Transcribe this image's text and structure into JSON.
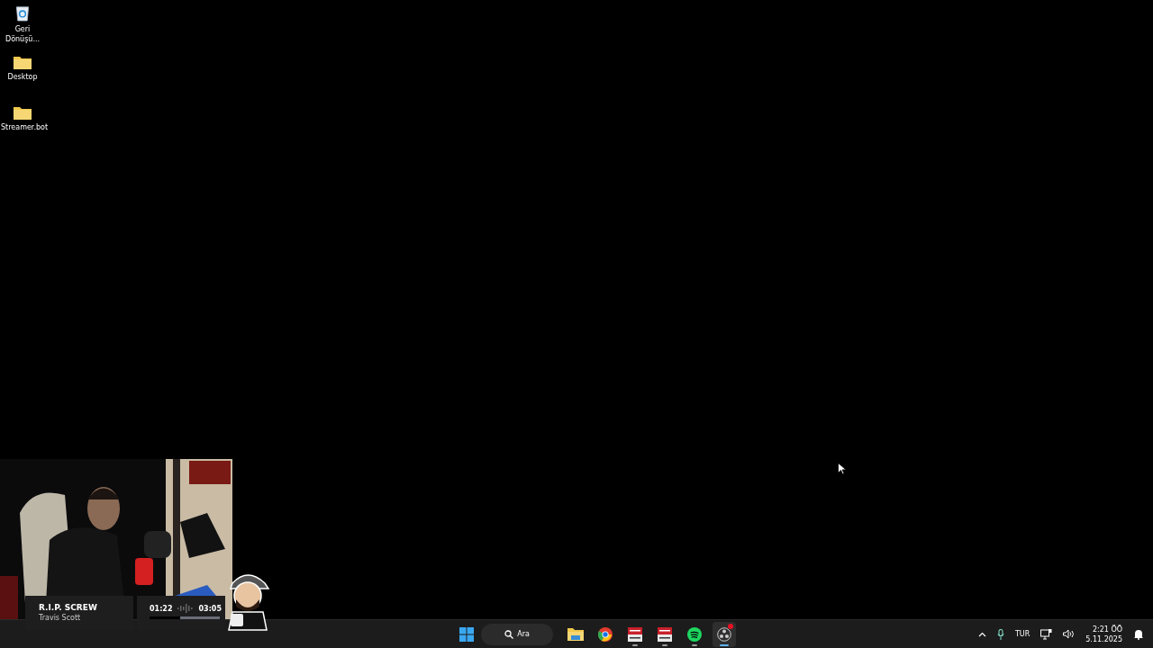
{
  "desktop_icons": [
    {
      "kind": "recycle",
      "label": "Geri Dönüşü..."
    },
    {
      "kind": "folder",
      "label": "Desktop"
    },
    {
      "kind": "folder",
      "label": "Streamer.bot"
    }
  ],
  "media": {
    "title": "R.I.P. SCREW",
    "artist": "Travis Scott",
    "elapsed": "01:22",
    "duration": "03:05",
    "level": 0.43
  },
  "taskbar": {
    "search": {
      "label": "Ara"
    },
    "apps": [
      {
        "kind": "files",
        "running": false,
        "selected": false,
        "alert": false
      },
      {
        "kind": "chrome",
        "running": false,
        "selected": false,
        "alert": false
      },
      {
        "kind": "mixer",
        "running": true,
        "selected": false,
        "alert": false
      },
      {
        "kind": "mixer",
        "running": true,
        "selected": false,
        "alert": false
      },
      {
        "kind": "spotify",
        "running": true,
        "selected": false,
        "alert": false
      },
      {
        "kind": "obs",
        "running": true,
        "selected": true,
        "alert": true
      }
    ]
  },
  "tray": {
    "language": "TUR",
    "time": "2:21 ÖÖ",
    "date": "5.11.2025"
  }
}
